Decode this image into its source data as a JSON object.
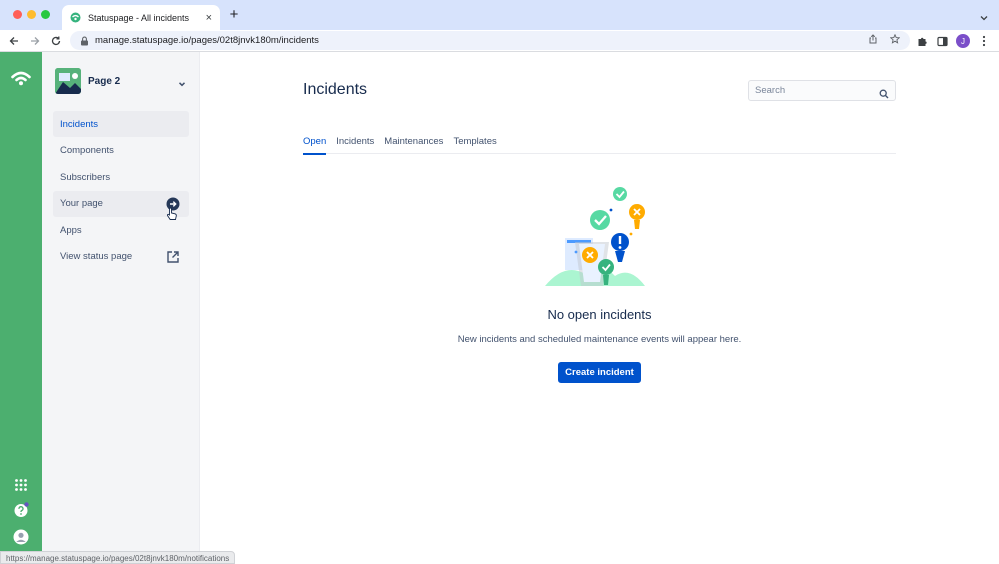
{
  "browser": {
    "tab_title": "Statuspage - All incidents",
    "tab_close": "×",
    "new_tab": "+",
    "url": "manage.statuspage.io/pages/02t8jnvk180m/incidents",
    "profile_initial": "J",
    "status_url": "https://manage.statuspage.io/pages/02t8jnvk180m/notifications"
  },
  "sidebar": {
    "page_name": "Page 2",
    "items": [
      {
        "label": "Incidents"
      },
      {
        "label": "Components"
      },
      {
        "label": "Subscribers"
      },
      {
        "label": "Your page"
      },
      {
        "label": "Apps"
      },
      {
        "label": "View status page"
      }
    ]
  },
  "main": {
    "title": "Incidents",
    "search_placeholder": "Search",
    "tabs": [
      {
        "label": "Open"
      },
      {
        "label": "Incidents"
      },
      {
        "label": "Maintenances"
      },
      {
        "label": "Templates"
      }
    ],
    "empty_title": "No open incidents",
    "empty_desc": "New incidents and scheduled maintenance events will appear here.",
    "create_button": "Create incident"
  },
  "colors": {
    "rail": "#4caf6f",
    "primary": "#0052cc",
    "sidebar_bg": "#f4f5f7"
  }
}
